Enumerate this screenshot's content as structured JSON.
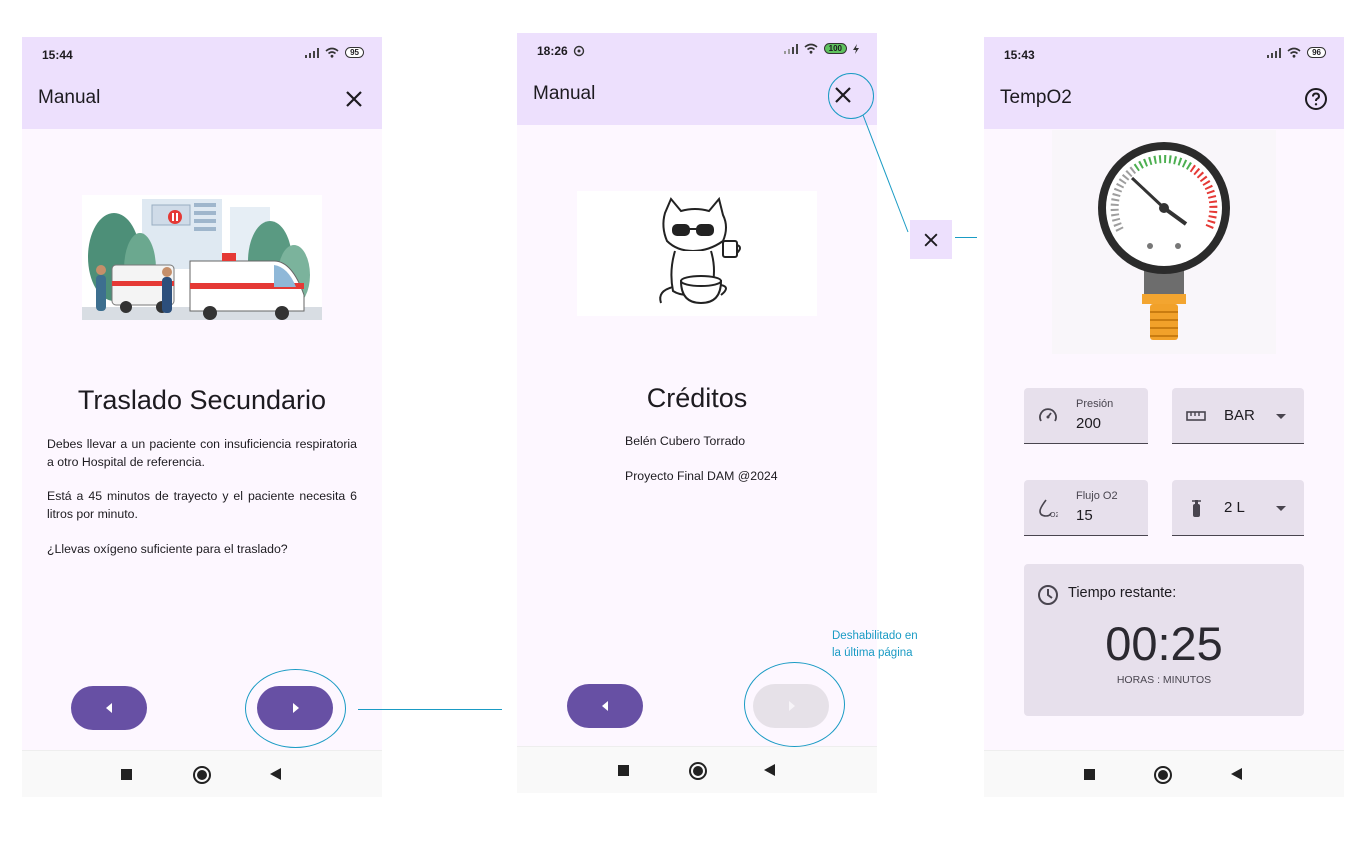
{
  "phone1": {
    "time": "15:44",
    "battery": "95",
    "title": "Manual",
    "heading": "Traslado Secundario",
    "paragraphs": [
      "Debes llevar a un paciente con insuficiencia respiratoria a otro Hospital de referencia.",
      "Está a 45 minutos de trayecto y el paciente necesita 6 litros por minuto.",
      "¿Llevas oxígeno suficiente para el traslado?"
    ]
  },
  "phone2": {
    "time": "18:26",
    "battery": "100",
    "title": "Manual",
    "heading": "Créditos",
    "author": "Belén Cubero Torrado",
    "project": "Proyecto Final DAM @2024"
  },
  "annotation": {
    "note_line1": "Deshabilitado en",
    "note_line2": "la última página"
  },
  "phone3": {
    "time": "15:43",
    "battery": "96",
    "title": "TempO2",
    "pressure_label": "Presión",
    "pressure_value": "200",
    "unit_value": "BAR",
    "flow_label": "Flujo O2",
    "flow_value": "15",
    "bottle_value": "2 L",
    "timer_title": "Tiempo restante:",
    "timer_value": "00:25",
    "timer_caption": "HORAS : MINUTOS"
  },
  "colors": {
    "primary": "#6750a4",
    "appbar": "#ede0fd",
    "annotation": "#1a9bc4"
  }
}
